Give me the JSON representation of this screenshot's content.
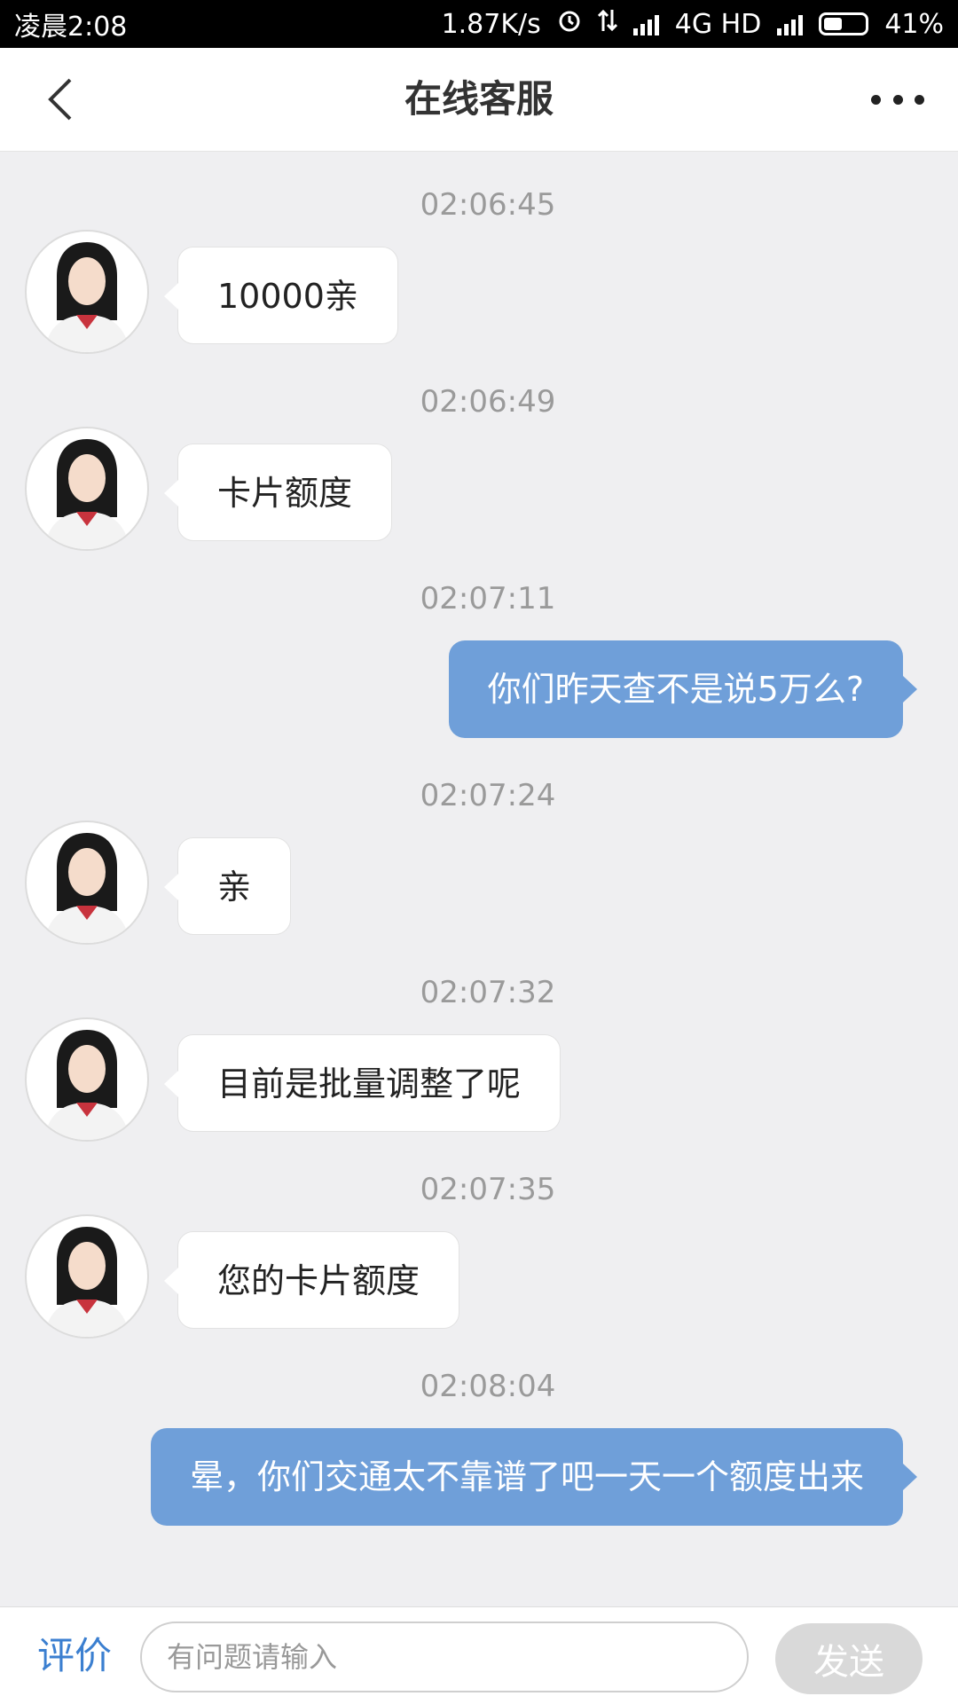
{
  "status_bar": {
    "time": "凌晨2:08",
    "net_speed": "1.87K/s",
    "network": "4G HD",
    "battery": "41%",
    "icons": [
      "alarm-icon",
      "data-transfer-icon",
      "signal-icon",
      "signal-icon",
      "battery-icon"
    ]
  },
  "header": {
    "title": "在线客服",
    "back_icon": "chevron-left-icon",
    "more_icon": "more-dots-icon"
  },
  "messages": [
    {
      "time": "02:06:45",
      "from": "agent",
      "text": "10000亲"
    },
    {
      "time": "02:06:49",
      "from": "agent",
      "text": "卡片额度"
    },
    {
      "time": "02:07:11",
      "from": "user",
      "text": "你们昨天查不是说5万么?"
    },
    {
      "time": "02:07:24",
      "from": "agent",
      "text": "亲"
    },
    {
      "time": "02:07:32",
      "from": "agent",
      "text": "目前是批量调整了呢"
    },
    {
      "time": "02:07:35",
      "from": "agent",
      "text": "您的卡片额度"
    },
    {
      "time": "02:08:04",
      "from": "user",
      "text": "晕，你们交通太不靠谱了吧一天一个额度出来"
    }
  ],
  "input_bar": {
    "rate_label": "评价",
    "placeholder": "有问题请输入",
    "send_label": "发送"
  },
  "colors": {
    "outgoing_bubble": "#6f9fd9",
    "incoming_bubble": "#ffffff",
    "chat_background": "#efeff1",
    "accent": "#3b7fd0"
  }
}
